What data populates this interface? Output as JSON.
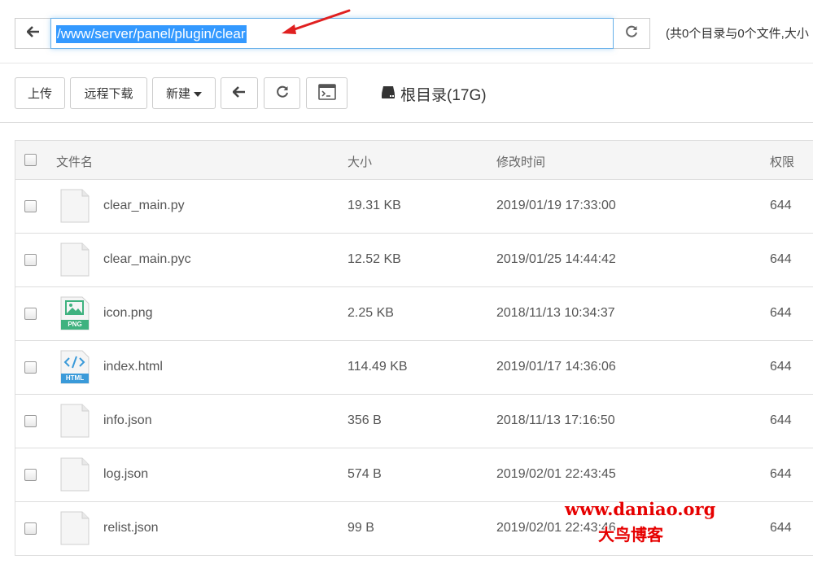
{
  "path_bar": {
    "path": "/www/server/panel/plugin/clear",
    "summary": "(共0个目录与0个文件,大小"
  },
  "toolbar": {
    "upload_label": "上传",
    "remote_download_label": "远程下载",
    "new_label": "新建",
    "root_label": "根目录(17G)"
  },
  "table": {
    "headers": {
      "name": "文件名",
      "size": "大小",
      "mtime": "修改时间",
      "perm": "权限"
    },
    "rows": [
      {
        "name": "clear_main.py",
        "size": "19.31 KB",
        "mtime": "2019/01/19 17:33:00",
        "perm": "644",
        "icon": "generic-file-icon"
      },
      {
        "name": "clear_main.pyc",
        "size": "12.52 KB",
        "mtime": "2019/01/25 14:44:42",
        "perm": "644",
        "icon": "generic-file-icon"
      },
      {
        "name": "icon.png",
        "size": "2.25 KB",
        "mtime": "2018/11/13 10:34:37",
        "perm": "644",
        "icon": "png-file-icon"
      },
      {
        "name": "index.html",
        "size": "114.49 KB",
        "mtime": "2019/01/17 14:36:06",
        "perm": "644",
        "icon": "html-file-icon"
      },
      {
        "name": "info.json",
        "size": "356 B",
        "mtime": "2018/11/13 17:16:50",
        "perm": "644",
        "icon": "generic-file-icon"
      },
      {
        "name": "log.json",
        "size": "574 B",
        "mtime": "2019/02/01 22:43:45",
        "perm": "644",
        "icon": "generic-file-icon"
      },
      {
        "name": "relist.json",
        "size": "99 B",
        "mtime": "2019/02/01 22:43:46",
        "perm": "644",
        "icon": "generic-file-icon"
      }
    ]
  },
  "icon_badges": {
    "png": "PNG",
    "html": "HTML"
  },
  "watermark": {
    "line1": "www.daniao.org",
    "line2": "大鸟博客"
  },
  "colors": {
    "selection": "#3399ff",
    "annotation_arrow": "#e02020",
    "watermark": "#e60000",
    "png_badge": "#3fb27f",
    "html_badge": "#3a9ad9"
  }
}
